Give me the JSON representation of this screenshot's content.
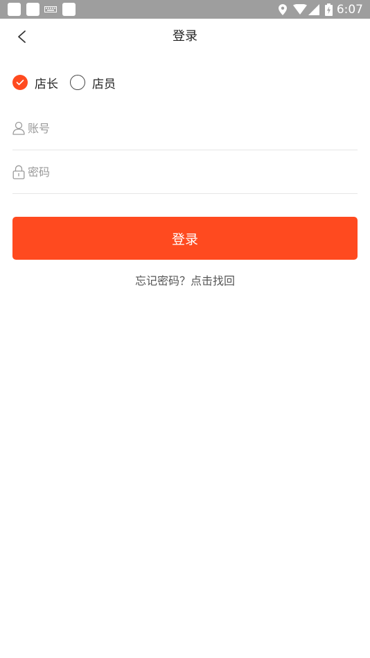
{
  "status_bar": {
    "time": "6:07",
    "icons": [
      "notification-square-icon",
      "notification-square-icon",
      "keyboard-icon",
      "notification-square-icon",
      "location-icon",
      "wifi-icon",
      "cell-signal-icon",
      "battery-charging-icon"
    ]
  },
  "nav": {
    "title": "登录",
    "back_icon": "chevron-left-icon"
  },
  "roles": [
    {
      "label": "店长",
      "checked": true
    },
    {
      "label": "店员",
      "checked": false
    }
  ],
  "account": {
    "placeholder": "账号",
    "icon": "user-icon"
  },
  "password": {
    "placeholder": "密码",
    "icon": "lock-icon"
  },
  "login_button": {
    "label": "登录"
  },
  "forgot_link": {
    "label": "忘记密码？点击找回"
  },
  "colors": {
    "accent": "#ff4a1f",
    "status_bar": "#9e9e9e",
    "divider": "#e6e6e6",
    "placeholder": "#9a9a9a"
  }
}
